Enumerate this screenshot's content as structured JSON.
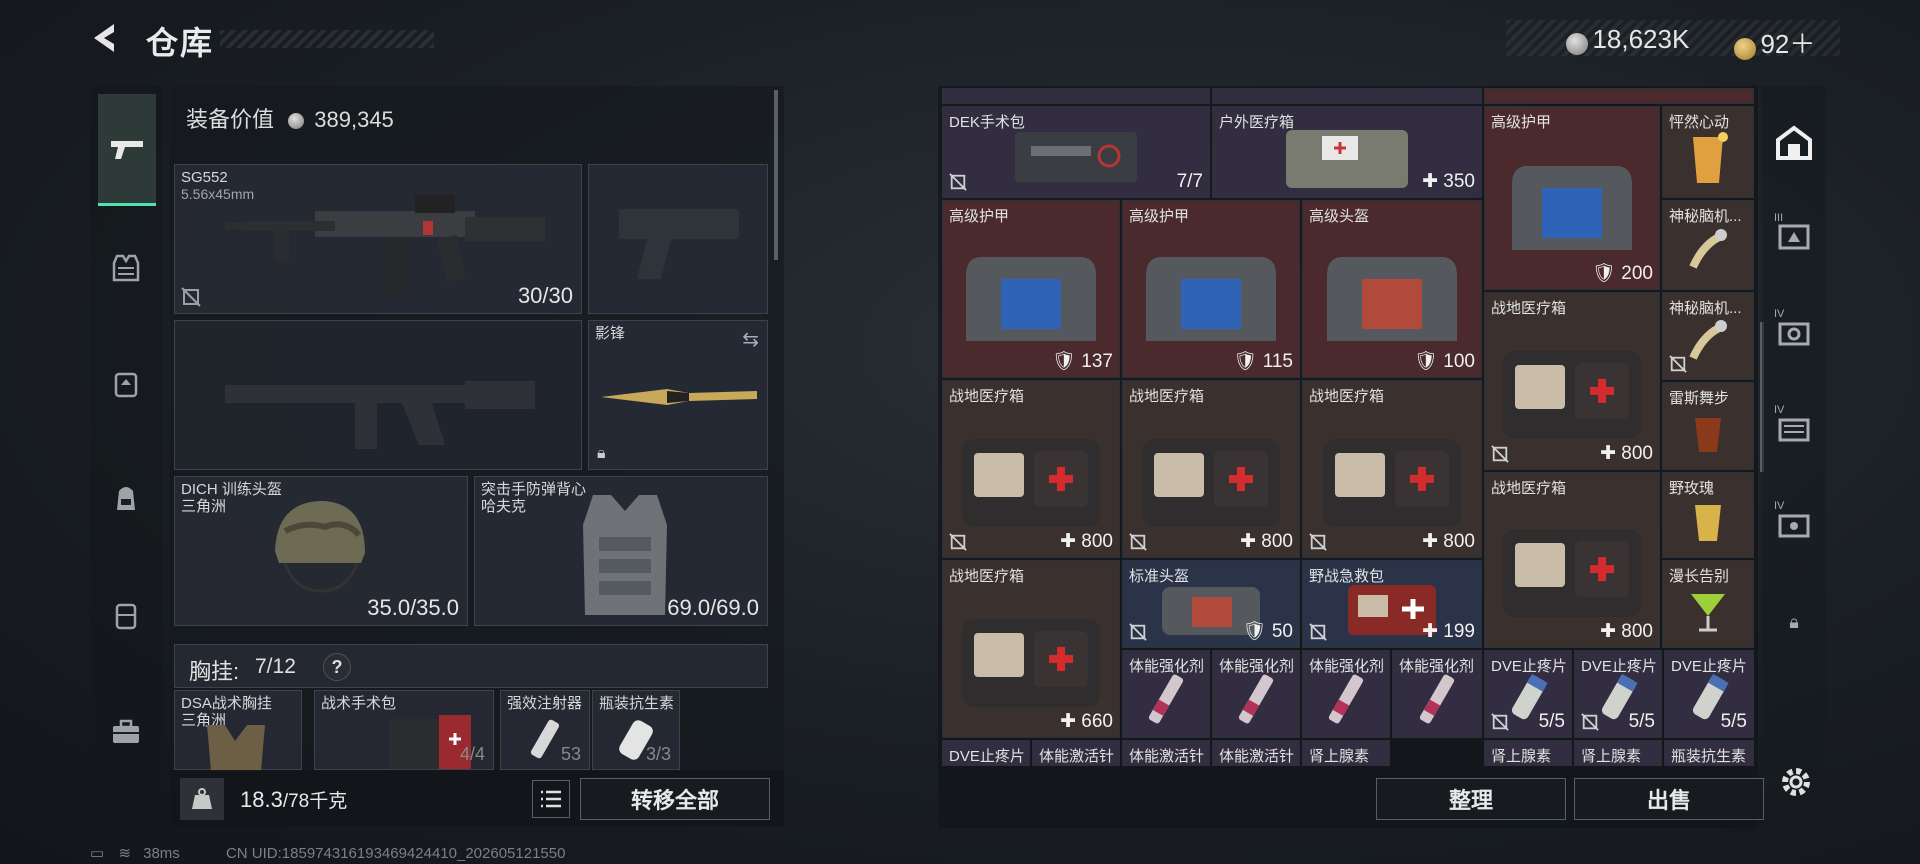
{
  "header": {
    "title": "仓库",
    "currency": [
      {
        "icon": "silver-coin-icon",
        "value": "18,623K"
      },
      {
        "icon": "gold-coin-icon",
        "value": "92＋"
      }
    ]
  },
  "left_nav": {
    "items": [
      {
        "name": "weapons",
        "icon": "pistol-icon",
        "active": true
      },
      {
        "name": "vest",
        "icon": "vest-icon"
      },
      {
        "name": "armor",
        "icon": "armor-icon"
      },
      {
        "name": "backpack",
        "icon": "backpack-icon"
      },
      {
        "name": "case",
        "icon": "case-icon"
      },
      {
        "name": "toolbox",
        "icon": "toolbox-icon"
      }
    ]
  },
  "loadout": {
    "equipment_value_label": "装备价值",
    "equipment_value": "389,345",
    "primary": {
      "name": "SG552",
      "caliber": "5.56x45mm",
      "ammo": "30/30"
    },
    "melee": {
      "name": "影锋"
    },
    "helmet": {
      "name": "DICH 训练头盔",
      "origin": "三角洲",
      "durability": "35.0/35.0"
    },
    "armor": {
      "name": "突击手防弹背心",
      "origin": "哈夫克",
      "durability": "69.0/69.0"
    },
    "chest_rig": {
      "label": "胸挂:",
      "capacity": "7/12",
      "help": "?"
    },
    "chest_items": [
      {
        "name": "DSA战术胸挂",
        "origin": "三角洲"
      },
      {
        "name": "战术手术包",
        "count": "4/4"
      },
      {
        "name": "强效注射器",
        "value": "53"
      },
      {
        "name": "瓶装抗生素",
        "count": "3/3"
      }
    ],
    "weight": {
      "value": "18.3",
      "max": "/78千克"
    },
    "transfer_all": "转移全部"
  },
  "storage": {
    "cells": [
      {
        "label": "DEK手术包",
        "value": "7/7"
      },
      {
        "label": "户外医疗箱",
        "value": "350"
      },
      {
        "label": "高级护甲",
        "value": "200"
      },
      {
        "label": "怦然心动",
        "value": ""
      },
      {
        "label": "高级护甲",
        "value": "137"
      },
      {
        "label": "高级护甲",
        "value": "115"
      },
      {
        "label": "高级头盔",
        "value": "100"
      },
      {
        "label": "神秘脑机...",
        "value": ""
      },
      {
        "label": "战地医疗箱",
        "value": "800"
      },
      {
        "label": "神秘脑机...",
        "value": ""
      },
      {
        "label": "战地医疗箱",
        "value": "800"
      },
      {
        "label": "战地医疗箱",
        "value": "800"
      },
      {
        "label": "战地医疗箱",
        "value": "800"
      },
      {
        "label": "雷斯舞步",
        "value": ""
      },
      {
        "label": "战地医疗箱",
        "value": "800"
      },
      {
        "label": "野玫瑰",
        "value": ""
      },
      {
        "label": "战地医疗箱",
        "value": "660"
      },
      {
        "label": "标准头盔",
        "value": "50"
      },
      {
        "label": "野战急救包",
        "value": "199"
      },
      {
        "label": "漫长告别",
        "value": ""
      },
      {
        "label": "体能强化剂",
        "value": ""
      },
      {
        "label": "体能强化剂",
        "value": ""
      },
      {
        "label": "体能强化剂",
        "value": ""
      },
      {
        "label": "体能强化剂",
        "value": ""
      },
      {
        "label": "DVE止疼片",
        "value": "5/5"
      },
      {
        "label": "DVE止疼片",
        "value": "5/5"
      },
      {
        "label": "DVE止疼片",
        "value": "5/5"
      },
      {
        "label": "DVE止疼片",
        "value": ""
      },
      {
        "label": "体能激活针",
        "value": ""
      },
      {
        "label": "体能激活针",
        "value": ""
      },
      {
        "label": "体能激活针",
        "value": ""
      },
      {
        "label": "肾上腺素",
        "value": ""
      },
      {
        "label": "肾上腺素",
        "value": ""
      },
      {
        "label": "肾上腺素",
        "value": ""
      },
      {
        "label": "瓶装抗生素",
        "value": ""
      }
    ],
    "tidy_button": "整理",
    "sell_button": "出售"
  },
  "right_nav": {
    "icons": [
      "storage-icon",
      "case-iii-icon",
      "case-iv-icon",
      "case-iv-2-icon",
      "case-iv-3-icon",
      "lock-icon",
      "settings-icon"
    ],
    "labels": [
      "III",
      "IV",
      "IV",
      "IV"
    ]
  },
  "status": {
    "ping": "38ms",
    "uid": "CN UID:18597431619346942441​0_202605121550"
  },
  "colors": {
    "accent": "#4fe3b0",
    "cell_red": "#4a2a2d",
    "cell_brown": "#3a302e",
    "cell_blue": "#2a3348"
  }
}
